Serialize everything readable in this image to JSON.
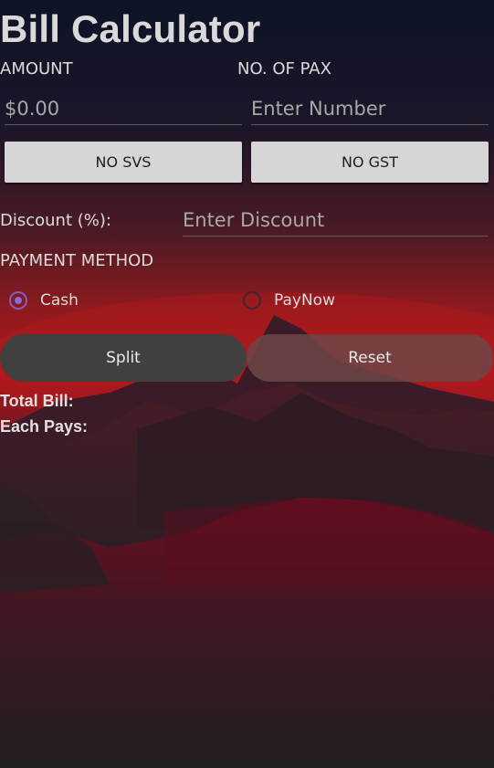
{
  "title": "Bill Calculator",
  "amount": {
    "label": "AMOUNT",
    "placeholder": "$0.00"
  },
  "pax": {
    "label": "NO. OF PAX",
    "placeholder": "Enter Number"
  },
  "toggles": {
    "svs_label": "NO SVS",
    "gst_label": "NO GST"
  },
  "discount": {
    "label": "Discount (%):",
    "placeholder": "Enter Discount"
  },
  "payment": {
    "label": "PAYMENT METHOD",
    "options": [
      "Cash",
      "PayNow"
    ],
    "selected": "Cash"
  },
  "actions": {
    "split_label": "Split",
    "reset_label": "Reset"
  },
  "results": {
    "total_label": "Total Bill:",
    "each_label": "Each Pays:"
  },
  "colors": {
    "radio_accent": "#8a6ad0",
    "toggle_bg": "#d6d6d6",
    "split_bg": "#404040",
    "reset_bg": "#6e4646",
    "bg_top": "#141624",
    "bg_red": "#a0141c",
    "bg_bottom": "#1f1c20"
  }
}
